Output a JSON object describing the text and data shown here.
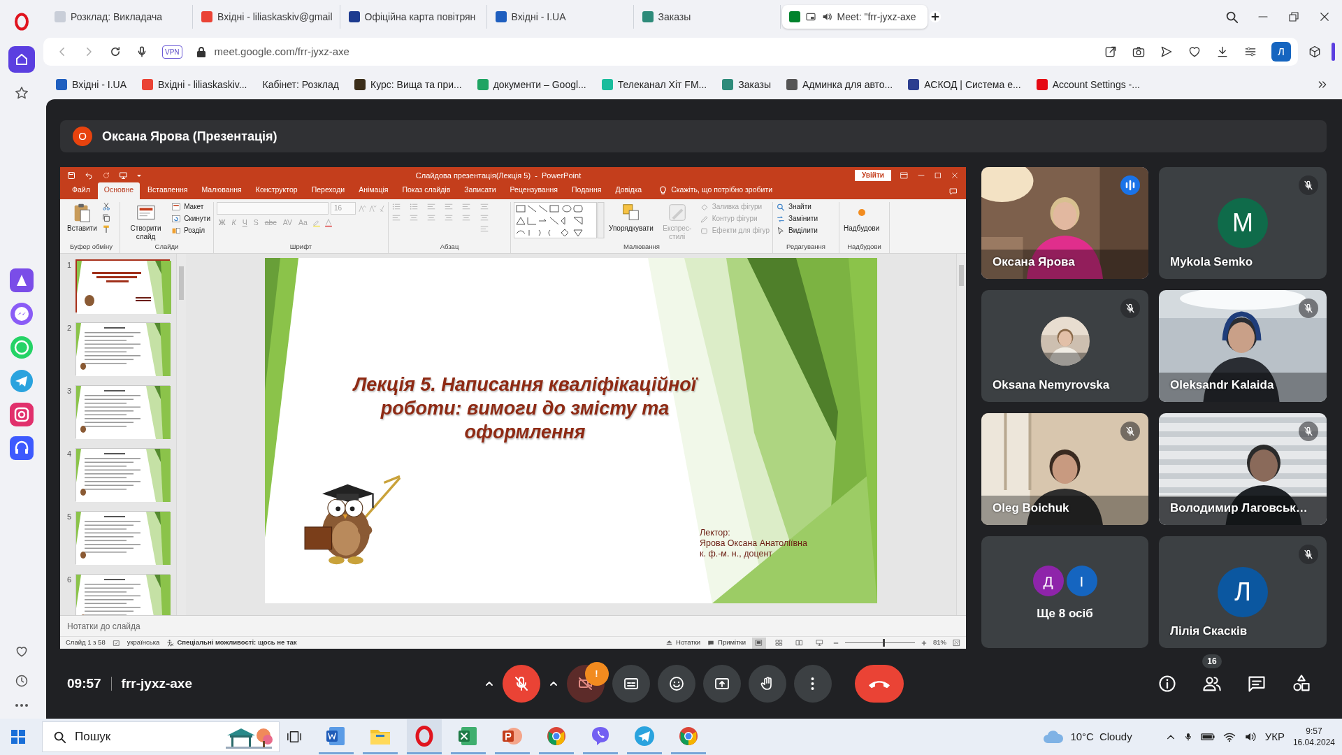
{
  "browser": {
    "tabs": [
      {
        "title": "Розклад: Викладача",
        "selected": false,
        "audio": false,
        "color": "#c9ced8"
      },
      {
        "title": "Вхідні - liliaskaskiv@gmail",
        "selected": false,
        "audio": false,
        "color": "#ea4335"
      },
      {
        "title": "Офіційна карта повітрян",
        "selected": false,
        "audio": false,
        "color": "#1d3b8f"
      },
      {
        "title": "Вхідні - I.UA",
        "selected": false,
        "audio": false,
        "color": "#1f5fbf"
      },
      {
        "title": "Заказы",
        "selected": false,
        "audio": false,
        "color": "#2e8b7a"
      },
      {
        "title": "Meet: \"frr-jyxz-axe",
        "selected": true,
        "audio": true,
        "color": "#00832d"
      }
    ],
    "vpn": "VPN",
    "address": "meet.google.com/frr-jyxz-axe",
    "profile_initial": "Л",
    "bookmarks": [
      {
        "title": "Вхідні - I.UA",
        "color": "#1f5fbf"
      },
      {
        "title": "Вхідні - liliaskaskiv...",
        "color": "#ea4335"
      },
      {
        "title": "Кабінет: Розклад"
      },
      {
        "title": "Курс: Вища та при...",
        "color": "#3b2e1a"
      },
      {
        "title": "документи – Googl...",
        "color": "#1fa463"
      },
      {
        "title": "Телеканал Хіт FM...",
        "color": "#1abc9c"
      },
      {
        "title": "Заказы",
        "color": "#2e8b7a"
      },
      {
        "title": "Админка для авто...",
        "color": "#555555"
      },
      {
        "title": "АСКОД | Система е...",
        "color": "#2c3e8f"
      },
      {
        "title": "Account Settings -...",
        "color": "#e50914"
      }
    ]
  },
  "meet": {
    "presenter": {
      "initial": "О",
      "label": "Оксана Ярова (Презентація)"
    },
    "powerpoint": {
      "title": "Слайдова презентація(Лекція 5)  -  PowerPoint",
      "sign_in": "Увійти",
      "tabs": [
        {
          "label": "Файл",
          "selected": false
        },
        {
          "label": "Основне",
          "selected": true
        },
        {
          "label": "Вставлення",
          "selected": false
        },
        {
          "label": "Малювання",
          "selected": false
        },
        {
          "label": "Конструктор",
          "selected": false
        },
        {
          "label": "Переходи",
          "selected": false
        },
        {
          "label": "Анімація",
          "selected": false
        },
        {
          "label": "Показ слайдів",
          "selected": false
        },
        {
          "label": "Записати",
          "selected": false
        },
        {
          "label": "Рецензування",
          "selected": false
        },
        {
          "label": "Подання",
          "selected": false
        },
        {
          "label": "Довідка",
          "selected": false
        }
      ],
      "tell_me": "Скажіть, що потрібно зробити",
      "ribbon_groups": [
        {
          "kind": "clipboard",
          "label": "Буфер обміну",
          "buttons": [
            {
              "label": "Вставити",
              "disabled": false
            }
          ]
        },
        {
          "kind": "slides",
          "label": "Слайди",
          "buttons": [
            {
              "label": "Створити слайд",
              "disabled": false
            }
          ],
          "small": [
            {
              "label": "Макет",
              "disabled": false
            },
            {
              "label": "Скинути",
              "disabled": false
            },
            {
              "label": "Розділ",
              "disabled": false
            }
          ]
        },
        {
          "kind": "font",
          "label": "Шрифт",
          "disabled": true,
          "font_size": "16",
          "format": [
            "Ж",
            "К",
            "Ч",
            "S",
            "abc",
            "AV",
            "Aa"
          ]
        },
        {
          "kind": "paragraph",
          "label": "Абзац",
          "disabled": true
        },
        {
          "kind": "drawing",
          "label": "Малювання",
          "buttons": [
            {
              "label": "Упорядкувати",
              "disabled": false
            },
            {
              "label": "Експрес-стилі",
              "disabled": true
            }
          ],
          "small": [
            {
              "label": "Заливка фігури",
              "disabled": true
            },
            {
              "label": "Контур фігури",
              "disabled": true
            },
            {
              "label": "Ефекти для фігур",
              "disabled": true
            }
          ]
        },
        {
          "kind": "editing",
          "label": "Редагування",
          "small": [
            {
              "label": "Знайти",
              "disabled": false
            },
            {
              "label": "Замінити",
              "disabled": false
            },
            {
              "label": "Виділити",
              "disabled": false
            }
          ]
        },
        {
          "kind": "addins",
          "label": "Надбудови",
          "buttons": [
            {
              "label": "Надбудови",
              "disabled": false
            }
          ]
        }
      ],
      "thumbnails": [
        {
          "number": "1",
          "selected": true
        },
        {
          "number": "2",
          "selected": false
        },
        {
          "number": "3",
          "selected": false
        },
        {
          "number": "4",
          "selected": false
        },
        {
          "number": "5",
          "selected": false
        },
        {
          "number": "6",
          "selected": false
        }
      ],
      "slide": {
        "title": "Лекція 5. Написання кваліфікаційної роботи: вимоги до змісту та оформлення",
        "lecturer": [
          "Лектор:",
          "Ярова Оксана Анатоліївна",
          "к. ф.-м. н., доцент"
        ]
      },
      "notes_placeholder": "Нотатки до слайда",
      "status": {
        "slide": "Слайд 1 з 58",
        "language": "українська",
        "accessibility": "Спеціальні можливості: щось не так",
        "notes": "Нотатки",
        "comments": "Примітки",
        "views": [
          {
            "kind": "normal",
            "selected": true
          },
          {
            "kind": "sorter",
            "selected": false
          },
          {
            "kind": "reading",
            "selected": false
          },
          {
            "kind": "slideshow",
            "selected": false
          }
        ],
        "zoom": {
          "level": 0.55,
          "reading": "81%"
        }
      }
    },
    "participants": [
      {
        "kind": "video",
        "name": "Оксана Ярова",
        "muted": false,
        "speaking": true
      },
      {
        "kind": "avatar",
        "name": "Mykola Semko",
        "muted": true,
        "speaking": false,
        "initial": "M",
        "color": "#0f6b4a"
      },
      {
        "name": "Oksana Nemyrovska",
        "muted": true,
        "speaking": false
      },
      {
        "kind": "video",
        "name": "Oleksandr Kalaida",
        "muted": true,
        "speaking": false
      },
      {
        "kind": "video",
        "name": "Oleg Boichuk",
        "muted": true,
        "speaking": false
      },
      {
        "kind": "video",
        "name": "Володимир Лаговськ…",
        "muted": true,
        "speaking": false
      },
      {
        "kind": "more",
        "name": "Ще 8 осіб",
        "muted": false,
        "speaking": false,
        "avatars": [
          {
            "initial": "Д",
            "color": "#8e24aa"
          },
          {
            "initial": "І",
            "color": "#1565c0"
          }
        ]
      },
      {
        "kind": "avatar",
        "name": "Лілія Скаскiв",
        "muted": true,
        "speaking": false,
        "initial": "Л",
        "color": "#0b57a0"
      }
    ],
    "time": "09:57",
    "meeting_code": "frr-jyxz-axe",
    "controls": {
      "mic_on": false,
      "camera_on": false,
      "camera_alert": "!"
    },
    "people_count": "16"
  },
  "taskbar": {
    "search": {
      "placeholder": "Пошук"
    },
    "apps": [
      {
        "kind": "document",
        "running": true,
        "selected": false
      },
      {
        "kind": "folder",
        "running": true,
        "selected": false
      },
      {
        "kind": "opera",
        "running": true,
        "selected": true
      },
      {
        "kind": "spreadsheet",
        "running": true,
        "selected": false
      },
      {
        "kind": "presentation",
        "running": true,
        "selected": false
      },
      {
        "kind": "chrome",
        "running": true,
        "selected": false
      },
      {
        "kind": "viber",
        "running": true,
        "selected": false
      },
      {
        "kind": "telegram",
        "running": true,
        "selected": false
      },
      {
        "kind": "chrome",
        "running": true,
        "selected": false
      }
    ],
    "temperature": "10°C",
    "condition": "Cloudy",
    "language": "УКР",
    "time": "9:57",
    "date": "16.04.2024"
  }
}
